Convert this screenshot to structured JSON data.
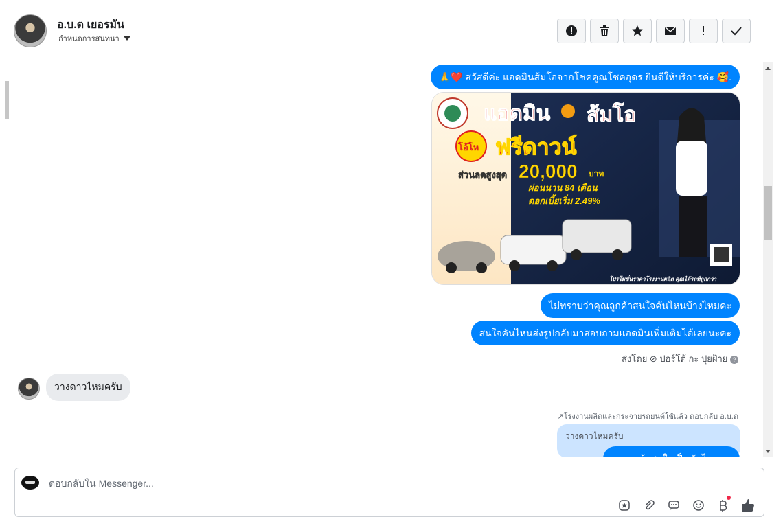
{
  "contact": {
    "name": "อ.บ.ต เยอรมัน",
    "sub_label": "กำหนดการสนทนา"
  },
  "toolbar": {
    "icons": [
      "alert-circle-icon",
      "trash-icon",
      "star-icon",
      "mail-icon",
      "exclamation-icon",
      "check-icon"
    ]
  },
  "messages": {
    "greeting": "🙏❤️ สวัสดีค่ะ แอดมินส้มโอจากโชคคูณโชคอุดร ยินดีให้บริการค่ะ 🥰.",
    "promo": {
      "brand": "แอดมิน",
      "brand2": "ส้มโอ",
      "badge": "โอ้โห",
      "headline": "ฟรีดาวน์",
      "discount_label": "ส่วนลดสูงสุด",
      "discount_value": "20,000",
      "discount_unit": "บาท",
      "installment": "ผ่อนนาน 84 เดือน",
      "interest": "ดอกเบี้ยเริ่ม 2.49%",
      "footer": "โปรโมชั่นราคาโรงงานผลิต คุณได้รถที่ถูกกว่า"
    },
    "ask_which": "ไม่ทราบว่าคุณลูกค้าสนใจคันไหนบ้างไหมคะ",
    "send_photo": "สนใจคันไหนส่งรูปกลับมาสอบถามแอดมินเพิ่มเติมได้เลยนะคะ",
    "sent_by": "ส่งโดย ⊘ ปอร์โต้ กะ ปุยฝ้าย",
    "customer_msg": "วางดาวไหมครับ",
    "reply_note": "↗โรงงานผลิตและกระจายรถยนต์ใช้แล้ว ตอบกลับ อ.บ.ต",
    "quoted_text": "วางดาวไหมครับ",
    "partial_reply": "คุณลูกค้าสนใจเป็นคันไหนคะ"
  },
  "composer": {
    "placeholder": "ตอบกลับใน Messenger..."
  },
  "colors": {
    "accent": "#0084ff",
    "incoming": "#e9ebee",
    "quoted": "#cce4ff"
  }
}
